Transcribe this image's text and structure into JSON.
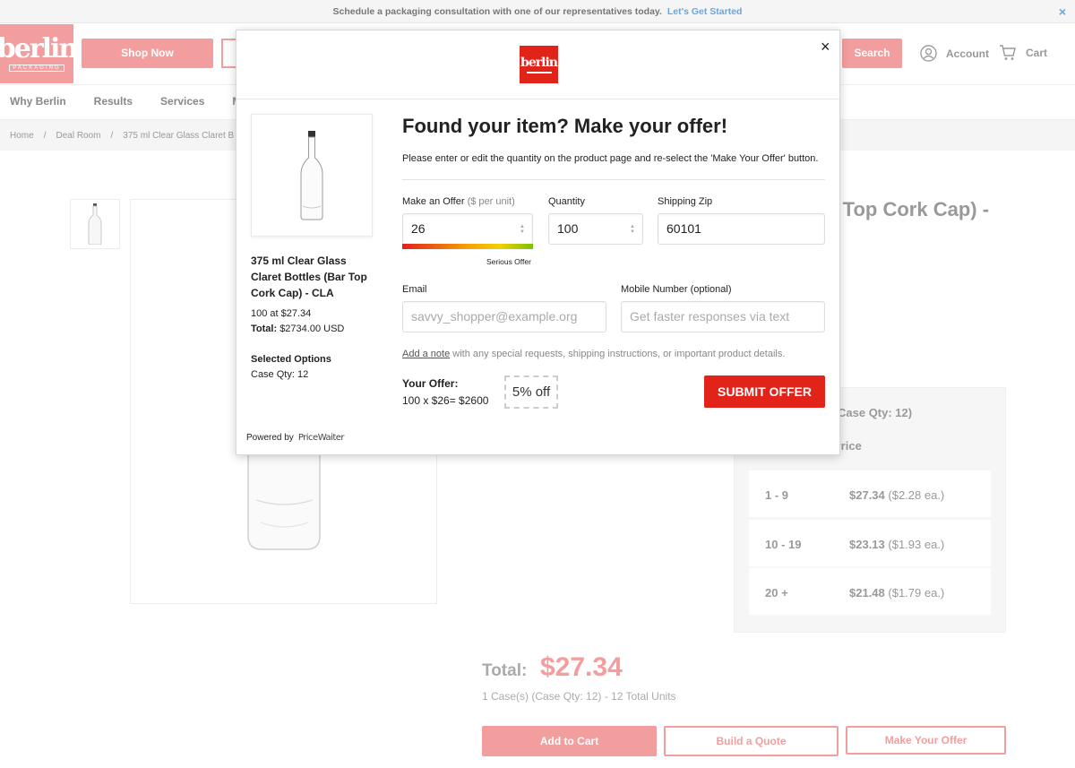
{
  "announcement": {
    "text": "Schedule a packaging consultation with one of our representatives today.",
    "link": "Let's Get Started",
    "close": "×"
  },
  "header": {
    "logo_text": "berlin",
    "logo_sub": "PACKAGING",
    "shop_now": "Shop Now",
    "search": "Search",
    "account": "Account",
    "cart": "Cart"
  },
  "nav": [
    "Why Berlin",
    "Results",
    "Services",
    "Ma"
  ],
  "breadcrumb": [
    "Home",
    "Deal Room",
    "375 ml Clear Glass Claret B"
  ],
  "product_page": {
    "title_fragment": "r Top Cork Cap) -",
    "case_qty_fragment": "Case Qty: 12)",
    "price_fragment": "Price",
    "tiers": [
      {
        "range": "1 - 9",
        "price": "$27.34",
        "each": "($2.28 ea.)"
      },
      {
        "range": "10 - 19",
        "price": "$23.13",
        "each": "($1.93 ea.)"
      },
      {
        "range": "20 +",
        "price": "$21.48",
        "each": "($1.79 ea.)"
      }
    ],
    "total_label": "Total:",
    "total_value": "$27.34",
    "total_sub": "1 Case(s) (Case Qty: 12) - 12 Total Units",
    "add_to_cart": "Add to Cart",
    "build_quote": "Build a Quote",
    "make_offer": "Make Your Offer"
  },
  "modal": {
    "logo_text": "berlin",
    "close": "×",
    "product_name": "375 ml Clear Glass Claret Bottles (Bar Top Cork Cap) - CLA",
    "qty_line": "100 at $27.34",
    "total_label": "Total:",
    "total_value": "$2734.00 USD",
    "selected_options_title": "Selected Options",
    "selected_options_value": "Case Qty: 12",
    "powered_by": "Powered by",
    "powered_brand": "PriceWaiter",
    "title": "Found your item? Make your offer!",
    "description": "Please enter or edit the quantity on the product page and re-select the 'Make Your Offer' button.",
    "offer_label": "Make an Offer",
    "offer_unit": "($ per unit)",
    "offer_value": "26",
    "offer_strength_label": "Serious Offer",
    "quantity_label": "Quantity",
    "quantity_value": "100",
    "zip_label": "Shipping Zip",
    "zip_value": "60101",
    "email_label": "Email",
    "email_placeholder": "savvy_shopper@example.org",
    "mobile_label": "Mobile Number (optional)",
    "mobile_placeholder": "Get faster responses via text",
    "note_link": "Add a note",
    "note_text": "with any special requests, shipping instructions, or important product details.",
    "your_offer_label": "Your Offer:",
    "your_offer_calc": "100 x $26= $2600",
    "discount": "5% off",
    "submit": "SUBMIT OFFER"
  },
  "colors": {
    "brand_red": "#e2231a",
    "brand_pink": "#f39e9e",
    "link_blue": "#6aa6de"
  }
}
